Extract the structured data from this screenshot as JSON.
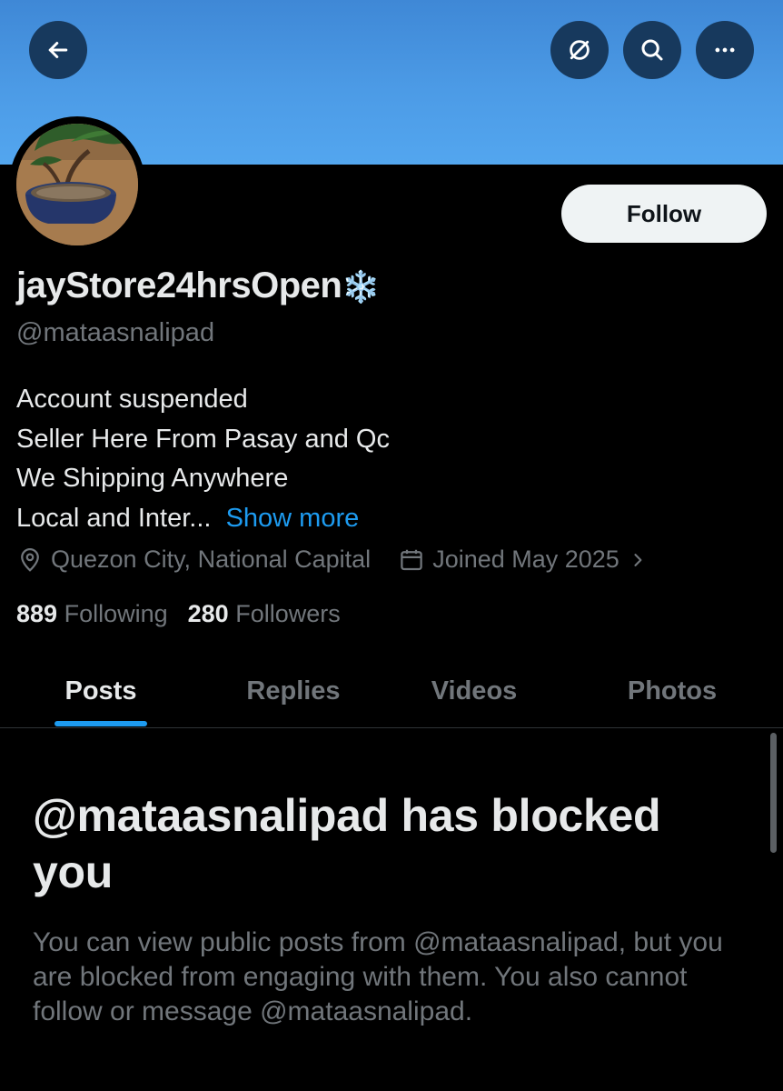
{
  "header": {
    "back_icon": "arrow-left-icon",
    "globe_icon": "no-globe-icon",
    "search_icon": "search-icon",
    "more_icon": "more-icon",
    "banner_color": "#4c9be6"
  },
  "profile": {
    "avatar": "bonsai tree avatar",
    "display_name": "jayStore24hrsOpen",
    "name_emoji": "❄️",
    "handle": "@mataasnalipad",
    "follow_label": "Follow",
    "bio_lines": [
      "Account suspended",
      "Seller Here From Pasay and Qc",
      "We Shipping Anywhere",
      "Local and Inter..."
    ],
    "show_more": "Show more",
    "location": "Quezon City, National Capital",
    "joined": "Joined May 2025",
    "following_count": "889",
    "following_label": "Following",
    "followers_count": "280",
    "followers_label": "Followers"
  },
  "tabs": [
    {
      "label": "Posts",
      "active": true
    },
    {
      "label": "Replies",
      "active": false
    },
    {
      "label": "Videos",
      "active": false
    },
    {
      "label": "Photos",
      "active": false
    }
  ],
  "blocked": {
    "title": "@mataasnalipad has blocked you",
    "text": "You can view public posts from @mataasnalipad, but you are blocked from engaging with them. You also cannot follow or message @mataasnalipad."
  },
  "colors": {
    "accent": "#1d9bf0",
    "background": "#000000",
    "text_primary": "#e7e9ea",
    "text_secondary": "#71767b"
  }
}
